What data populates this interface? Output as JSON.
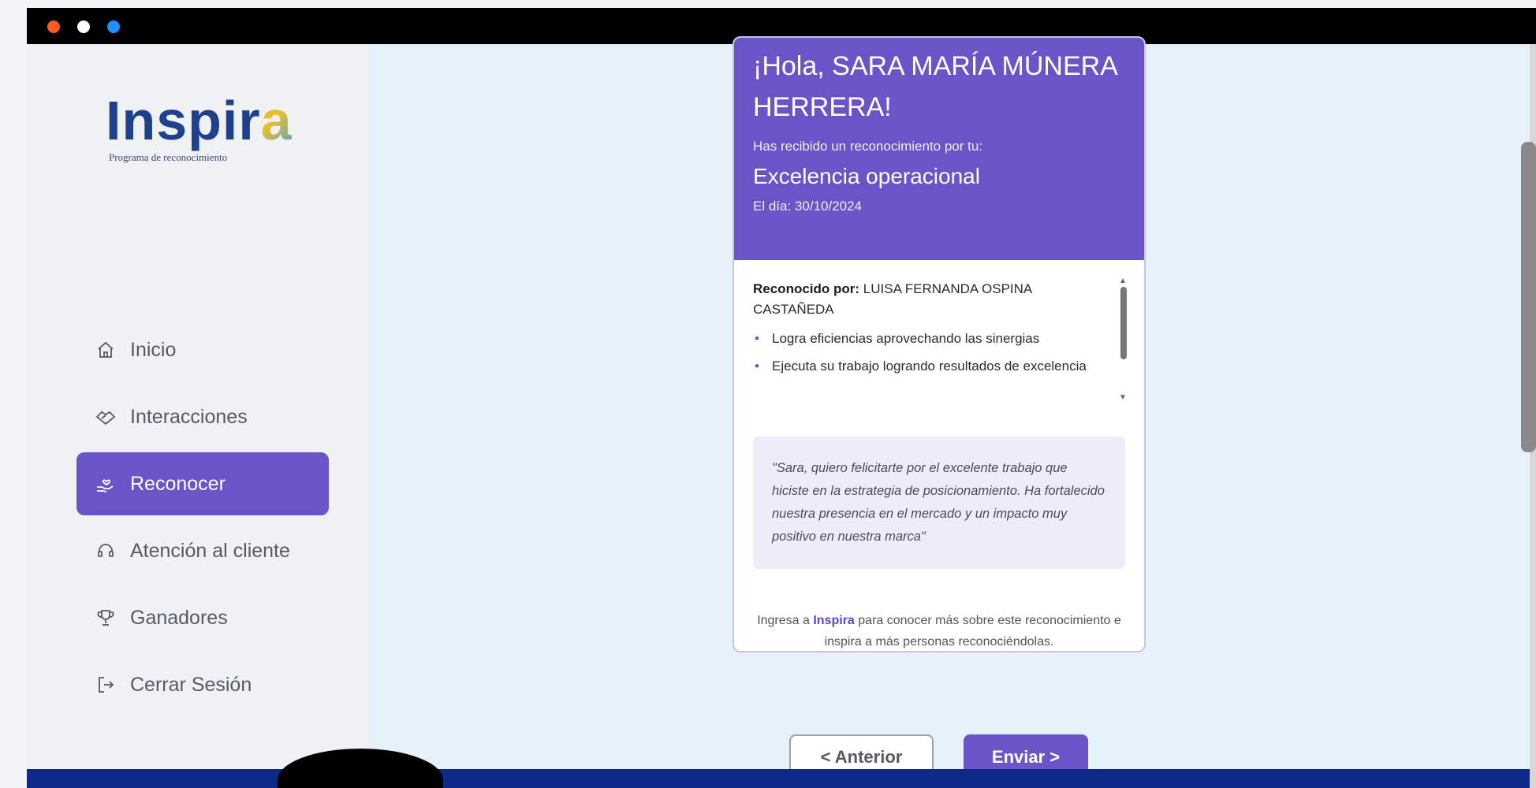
{
  "window": {
    "controls": [
      "close",
      "minimize",
      "maximize"
    ]
  },
  "sidebar": {
    "logo": {
      "word_main": "Inspir",
      "word_accent": "a",
      "subtitle": "Programa de reconocimiento"
    },
    "items": [
      {
        "label": "Inicio",
        "icon": "home-icon",
        "active": false
      },
      {
        "label": "Interacciones",
        "icon": "hands-icon",
        "active": false
      },
      {
        "label": "Reconocer",
        "icon": "heart-hand-icon",
        "active": true
      },
      {
        "label": "Atención al cliente",
        "icon": "headset-icon",
        "active": false
      },
      {
        "label": "Ganadores",
        "icon": "trophy-icon",
        "active": false
      },
      {
        "label": "Cerrar Sesión",
        "icon": "logout-icon",
        "active": false
      }
    ]
  },
  "card": {
    "greeting": "¡Hola, SARA MARÍA MÚNERA HERRERA!",
    "received_text": "Has recibido un reconocimiento por tu:",
    "recognition": "Excelencia operacional",
    "date": "El día: 30/10/2024",
    "recognized_by_label": "Reconocido por:",
    "recognized_by_name": "LUISA FERNANDA OSPINA CASTAÑEDA",
    "bullets": [
      "Logra eficiencias aprovechando las sinergias",
      "Ejecuta su trabajo logrando resultados de excelencia"
    ],
    "quote": "\"Sara, quiero felicitarte por el excelente trabajo que hiciste en la estrategia de posicionamiento. Ha fortalecido nuestra presencia en el mercado y un impacto muy positivo en nuestra marca\"",
    "footer_pre": "Ingresa a",
    "footer_brand": "Inspira",
    "footer_post": "para conocer más sobre este reconocimiento e inspira a más personas reconociéndolas."
  },
  "buttons": {
    "prev": "< Anterior",
    "next": "Enviar >"
  },
  "colors": {
    "accent": "#6a55c8",
    "brand_blue": "#1f3f8f",
    "bottom_bar": "#0b2a8a"
  }
}
